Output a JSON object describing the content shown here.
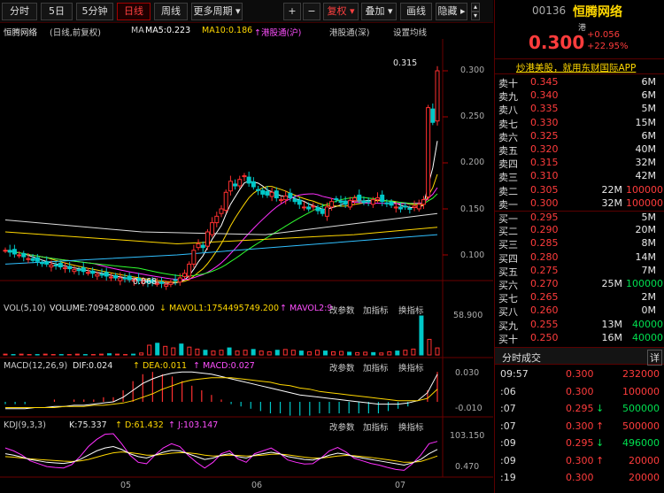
{
  "toolbar": {
    "tabs": [
      {
        "label": "分时",
        "active": false
      },
      {
        "label": "5日",
        "active": false
      },
      {
        "label": "5分钟",
        "active": false
      },
      {
        "label": "日线",
        "active": true
      },
      {
        "label": "周线",
        "active": false
      },
      {
        "label": "更多周期 ▾",
        "active": false
      }
    ],
    "plus": "+",
    "minus": "−",
    "fuquan": "复权 ▾",
    "diejia": "叠加 ▾",
    "huaxian": "画线",
    "yincang": "隐藏 ▸",
    "arrow_up": "▴",
    "arrow_down": "▾"
  },
  "chart": {
    "stock_label": "恒腾网络",
    "mode_label": "(日线,前复权)",
    "ma_label": "MA",
    "ma5": "MA5:0.223",
    "ma10": "MA10:0.186",
    "ma_extra": "↑港股通(沪)",
    "hk_connect": "港股通(深)",
    "settings": "设置均线",
    "high_label": "0.315",
    "low_label": "0.068",
    "price_ticks": [
      "0.300",
      "0.250",
      "0.200",
      "0.150",
      "0.100"
    ],
    "vol_title": "VOL(5,10)",
    "volume": "VOLUME:709428000.000",
    "mavol1": "↓ MAVOL1:1754495749.200",
    "mavol2": "↑ MAVOL2:9",
    "change_params": "改参数",
    "add_indicator": "加指标",
    "switch_indicator": "换指标",
    "vol_tick": "58.900",
    "macd_title": "MACD(12,26,9)",
    "dif": "DIF:0.024",
    "dea": "↑ DEA:0.011",
    "macd": "↑ MACD:0.027",
    "macd_tick_top": "0.030",
    "macd_tick_bot": "-0.010",
    "kdj_title": "KDJ(9,3,3)",
    "k": "K:75.337",
    "d": "↑ D:61.432",
    "j": "↑ J:103.147",
    "kdj_tick_top": "103.150",
    "kdj_tick_bot": "0.470",
    "months": [
      "05",
      "06",
      "07"
    ],
    "colors": {
      "up": "#ff3030",
      "down": "#00c8c8",
      "ma5": "#ffffff",
      "ma10": "#ffd700",
      "ma20": "#ff30ff",
      "ma30": "#30ff30"
    }
  },
  "quote": {
    "code": "00136",
    "name": "恒腾网络",
    "badge": "港",
    "price": "0.300",
    "change": "+0.056",
    "pct": "+22.95%",
    "promo": "炒港美股，就用东财国际APP",
    "asks": [
      {
        "label": "卖十",
        "price": "0.345",
        "vol": "6M",
        "extra": ""
      },
      {
        "label": "卖九",
        "price": "0.340",
        "vol": "6M",
        "extra": ""
      },
      {
        "label": "卖八",
        "price": "0.335",
        "vol": "5M",
        "extra": ""
      },
      {
        "label": "卖七",
        "price": "0.330",
        "vol": "15M",
        "extra": ""
      },
      {
        "label": "卖六",
        "price": "0.325",
        "vol": "6M",
        "extra": ""
      },
      {
        "label": "卖五",
        "price": "0.320",
        "vol": "40M",
        "extra": ""
      },
      {
        "label": "卖四",
        "price": "0.315",
        "vol": "32M",
        "extra": ""
      },
      {
        "label": "卖三",
        "price": "0.310",
        "vol": "42M",
        "extra": ""
      },
      {
        "label": "卖二",
        "price": "0.305",
        "vol": "22M",
        "extra": "100000"
      },
      {
        "label": "卖一",
        "price": "0.300",
        "vol": "32M",
        "extra": "100000"
      }
    ],
    "bids": [
      {
        "label": "买一",
        "price": "0.295",
        "vol": "5M",
        "extra": ""
      },
      {
        "label": "买二",
        "price": "0.290",
        "vol": "20M",
        "extra": ""
      },
      {
        "label": "买三",
        "price": "0.285",
        "vol": "8M",
        "extra": ""
      },
      {
        "label": "买四",
        "price": "0.280",
        "vol": "14M",
        "extra": ""
      },
      {
        "label": "买五",
        "price": "0.275",
        "vol": "7M",
        "extra": ""
      },
      {
        "label": "买六",
        "price": "0.270",
        "vol": "25M",
        "extra": "100000"
      },
      {
        "label": "买七",
        "price": "0.265",
        "vol": "2M",
        "extra": ""
      },
      {
        "label": "买八",
        "price": "0.260",
        "vol": "0M",
        "extra": ""
      },
      {
        "label": "买九",
        "price": "0.255",
        "vol": "13M",
        "extra": "40000"
      },
      {
        "label": "买十",
        "price": "0.250",
        "vol": "16M",
        "extra": "40000"
      }
    ],
    "trades_title": "分时成交",
    "trades_detail": "详",
    "trades": [
      {
        "time": "09:57",
        "price": "0.300",
        "arrow": "",
        "vol": "232000",
        "dir": "up"
      },
      {
        "time": ":06",
        "price": "0.300",
        "arrow": "",
        "vol": "100000",
        "dir": "up"
      },
      {
        "time": ":07",
        "price": "0.295",
        "arrow": "↓",
        "vol": "500000",
        "dir": "down"
      },
      {
        "time": ":07",
        "price": "0.300",
        "arrow": "↑",
        "vol": "500000",
        "dir": "up"
      },
      {
        "time": ":09",
        "price": "0.295",
        "arrow": "↓",
        "vol": "496000",
        "dir": "down"
      },
      {
        "time": ":09",
        "price": "0.300",
        "arrow": "↑",
        "vol": "20000",
        "dir": "up"
      },
      {
        "time": ":19",
        "price": "0.300",
        "arrow": "",
        "vol": "20000",
        "dir": "up"
      }
    ]
  },
  "chart_data": {
    "type": "candlestick",
    "xlabel": "",
    "ylabel": "",
    "ylim": [
      0.068,
      0.33
    ],
    "months": [
      "05",
      "06",
      "07"
    ],
    "series_price": [
      0.105,
      0.103,
      0.101,
      0.1,
      0.098,
      0.096,
      0.094,
      0.093,
      0.091,
      0.09,
      0.089,
      0.088,
      0.087,
      0.086,
      0.085,
      0.084,
      0.083,
      0.082,
      0.081,
      0.08,
      0.079,
      0.078,
      0.077,
      0.076,
      0.075,
      0.075,
      0.074,
      0.073,
      0.073,
      0.072,
      0.071,
      0.07,
      0.07,
      0.069,
      0.069,
      0.068,
      0.07,
      0.072,
      0.075,
      0.08,
      0.09,
      0.105,
      0.112,
      0.108,
      0.125,
      0.135,
      0.142,
      0.15,
      0.168,
      0.18,
      0.175,
      0.182,
      0.186,
      0.178,
      0.174,
      0.17,
      0.166,
      0.165,
      0.168,
      0.162,
      0.16,
      0.164,
      0.162,
      0.158,
      0.155,
      0.152,
      0.15,
      0.153,
      0.148,
      0.145,
      0.152,
      0.158,
      0.16,
      0.157,
      0.155,
      0.159,
      0.162,
      0.16,
      0.157,
      0.158,
      0.16,
      0.162,
      0.158,
      0.156,
      0.154,
      0.152,
      0.15,
      0.152,
      0.15,
      0.153,
      0.155,
      0.16,
      0.26,
      0.244,
      0.3
    ],
    "ma5": [
      0.104,
      0.102,
      0.1,
      0.098,
      0.096,
      0.094,
      0.092,
      0.09,
      0.088,
      0.086,
      0.085,
      0.084,
      0.083,
      0.082,
      0.081,
      0.08,
      0.079,
      0.078,
      0.077,
      0.076,
      0.075,
      0.074,
      0.073,
      0.072,
      0.072,
      0.071,
      0.071,
      0.07,
      0.07,
      0.07,
      0.07,
      0.071,
      0.073,
      0.077,
      0.083,
      0.091,
      0.101,
      0.11,
      0.12,
      0.13,
      0.14,
      0.15,
      0.158,
      0.166,
      0.172,
      0.176,
      0.178,
      0.176,
      0.173,
      0.17,
      0.167,
      0.165,
      0.163,
      0.162,
      0.16,
      0.158,
      0.156,
      0.154,
      0.152,
      0.152,
      0.153,
      0.154,
      0.155,
      0.156,
      0.157,
      0.158,
      0.158,
      0.157,
      0.156,
      0.155,
      0.154,
      0.153,
      0.152,
      0.152,
      0.153,
      0.174,
      0.192,
      0.214
    ],
    "kdj_k": [
      60,
      55,
      48,
      40,
      35,
      30,
      28,
      26,
      30,
      40,
      55,
      70,
      80,
      85,
      75,
      60,
      50,
      45,
      55,
      65,
      72,
      70,
      60,
      50,
      40,
      45,
      55,
      60,
      50,
      45,
      55,
      60,
      65,
      60,
      50,
      45,
      40,
      38,
      45,
      55,
      62,
      58,
      50,
      45,
      40,
      35,
      30,
      25,
      20,
      28,
      40,
      60,
      75
    ],
    "kdj_d": [
      50,
      48,
      45,
      42,
      40,
      38,
      36,
      34,
      33,
      35,
      40,
      48,
      56,
      63,
      66,
      64,
      60,
      55,
      55,
      58,
      62,
      64,
      63,
      60,
      55,
      52,
      53,
      55,
      54,
      52,
      53,
      55,
      58,
      59,
      56,
      52,
      48,
      45,
      45,
      48,
      52,
      54,
      53,
      50,
      47,
      43,
      39,
      35,
      30,
      30,
      33,
      42,
      52
    ],
    "kdj_j": [
      80,
      70,
      55,
      35,
      25,
      15,
      12,
      10,
      22,
      50,
      85,
      110,
      128,
      130,
      95,
      55,
      30,
      25,
      55,
      80,
      95,
      85,
      55,
      30,
      10,
      30,
      60,
      70,
      42,
      30,
      60,
      70,
      80,
      62,
      38,
      30,
      24,
      25,
      45,
      70,
      82,
      66,
      44,
      35,
      26,
      20,
      12,
      5,
      2,
      25,
      55,
      95,
      103.147
    ],
    "macd_dif": [
      -0.006,
      -0.006,
      -0.006,
      -0.005,
      -0.005,
      -0.004,
      -0.004,
      -0.003,
      -0.003,
      -0.002,
      -0.001,
      0.0,
      0.004,
      0.01,
      0.016,
      0.02,
      0.023,
      0.025,
      0.026,
      0.026,
      0.025,
      0.024,
      0.022,
      0.02,
      0.018,
      0.016,
      0.014,
      0.012,
      0.01,
      0.008,
      0.006,
      0.005,
      0.004,
      0.003,
      0.002,
      0.001,
      0.0,
      -0.001,
      -0.002,
      -0.002,
      -0.002,
      -0.001,
      0.001,
      0.008,
      0.024
    ],
    "macd_dea": [
      -0.005,
      -0.005,
      -0.005,
      -0.005,
      -0.005,
      -0.005,
      -0.004,
      -0.004,
      -0.004,
      -0.003,
      -0.003,
      -0.002,
      -0.001,
      0.001,
      0.004,
      0.007,
      0.011,
      0.014,
      0.017,
      0.019,
      0.02,
      0.021,
      0.021,
      0.021,
      0.02,
      0.019,
      0.018,
      0.017,
      0.015,
      0.014,
      0.012,
      0.011,
      0.009,
      0.008,
      0.007,
      0.006,
      0.005,
      0.004,
      0.003,
      0.002,
      0.001,
      0.001,
      0.001,
      0.003,
      0.011
    ],
    "volume": [
      0.02,
      0.01,
      0.02,
      0.01,
      0.01,
      0.02,
      0.01,
      0.01,
      0.01,
      0.02,
      0.01,
      0.01,
      0.02,
      0.03,
      0.02,
      0.01,
      0.02,
      0.05,
      0.25,
      0.3,
      0.22,
      0.18,
      0.28,
      0.2,
      0.15,
      0.12,
      0.1,
      0.12,
      0.18,
      0.1,
      0.12,
      0.14,
      0.1,
      0.08,
      0.12,
      0.14,
      0.12,
      0.1,
      0.08,
      0.12,
      0.1,
      0.08,
      0.09,
      0.07,
      0.06,
      0.07,
      0.06,
      0.05,
      0.08,
      0.1,
      0.12,
      0.15,
      1.0,
      0.4,
      0.18
    ]
  }
}
